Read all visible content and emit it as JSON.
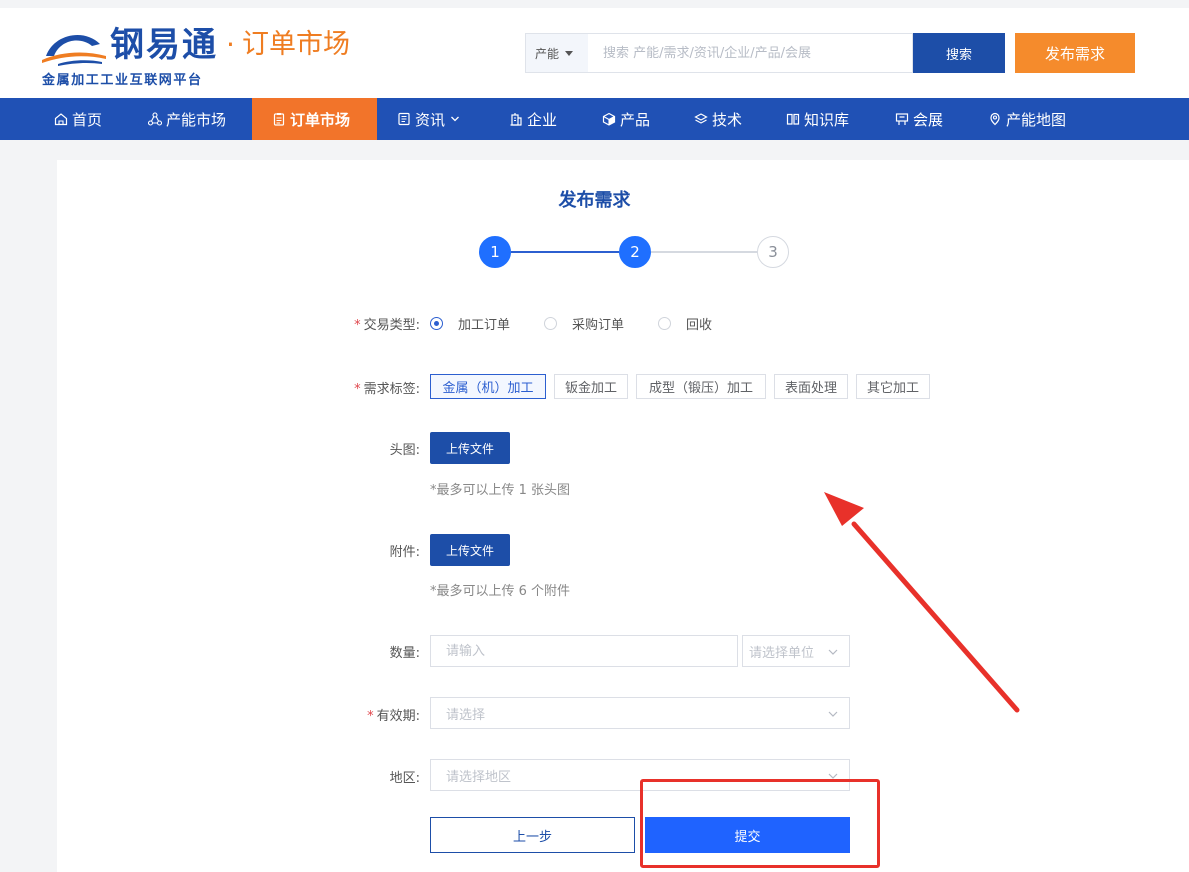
{
  "header": {
    "logo_name": "钢易通",
    "logo_dot": "·",
    "logo_section": "订单市场",
    "logo_subtitle": "金属加工工业互联网平台",
    "search_category": "产能",
    "search_placeholder": "搜索 产能/需求/资讯/企业/产品/会展",
    "search_button": "搜索",
    "publish_button": "发布需求"
  },
  "nav": {
    "items": [
      {
        "label": "首页",
        "icon": "home-icon"
      },
      {
        "label": "产能市场",
        "icon": "network-icon"
      },
      {
        "label": "订单市场",
        "icon": "clipboard-icon",
        "active": true
      },
      {
        "label": "资讯",
        "icon": "document-icon",
        "has_dropdown": true
      },
      {
        "label": "企业",
        "icon": "building-icon"
      },
      {
        "label": "产品",
        "icon": "cube-icon"
      },
      {
        "label": "技术",
        "icon": "layers-icon"
      },
      {
        "label": "知识库",
        "icon": "book-icon"
      },
      {
        "label": "会展",
        "icon": "exhibition-icon"
      },
      {
        "label": "产能地图",
        "icon": "map-pin-icon"
      }
    ]
  },
  "form": {
    "title": "发布需求",
    "steps": [
      "1",
      "2",
      "3"
    ],
    "current_step": 2,
    "required_mark": "*",
    "trade_type": {
      "label": "交易类型:",
      "options": [
        "加工订单",
        "采购订单",
        "回收"
      ],
      "selected": "加工订单"
    },
    "demand_tags": {
      "label": "需求标签:",
      "options": [
        "金属（机）加工",
        "钣金加工",
        "成型（锻压）加工",
        "表面处理",
        "其它加工"
      ],
      "selected": "金属（机）加工"
    },
    "head_image": {
      "label": "头图:",
      "button": "上传文件",
      "hint": "*最多可以上传 1 张头图"
    },
    "attachment": {
      "label": "附件:",
      "button": "上传文件",
      "hint": "*最多可以上传 6 个附件"
    },
    "quantity": {
      "label": "数量:",
      "placeholder": "请输入",
      "unit_placeholder": "请选择单位"
    },
    "validity": {
      "label": "有效期:",
      "placeholder": "请选择"
    },
    "region": {
      "label": "地区:",
      "placeholder": "请选择地区"
    },
    "prev_button": "上一步",
    "submit_button": "提交"
  },
  "colors": {
    "brand_blue": "#1d4ea8",
    "nav_blue": "#2051b5",
    "accent_orange": "#f58b2c",
    "active_orange": "#f2742a",
    "step_blue": "#1f6fff",
    "annotation_red": "#e8312a"
  }
}
